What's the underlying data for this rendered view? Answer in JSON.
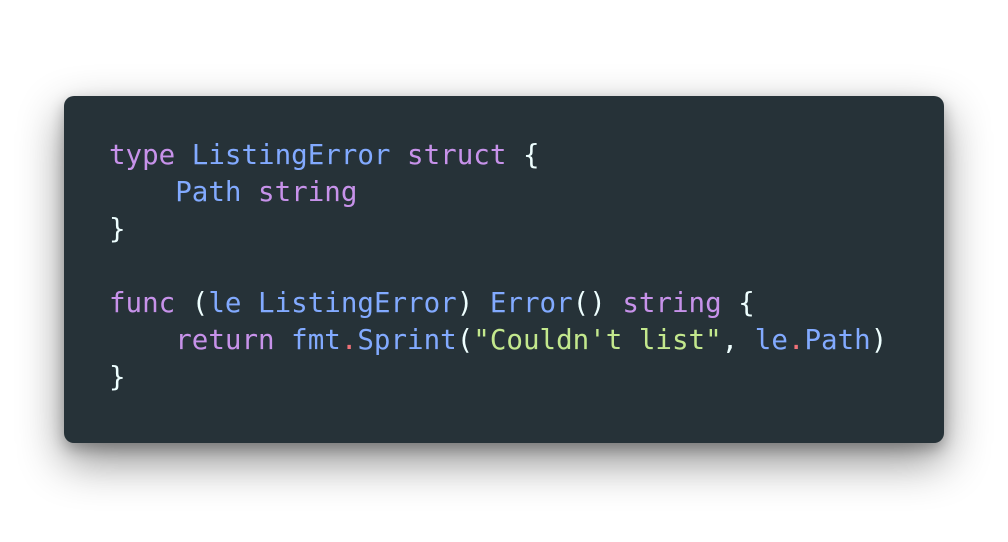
{
  "code": {
    "language": "Go",
    "colors": {
      "background": "#263238",
      "keyword": "#c792ea",
      "type": "#82aaff",
      "function": "#82aaff",
      "identifier": "#eeffff",
      "punctuation": "#eeffff",
      "dot": "#f07178",
      "string": "#c3e88d"
    },
    "lines": [
      [
        {
          "t": "type",
          "c": "kw"
        },
        {
          "t": " ",
          "c": "pn"
        },
        {
          "t": "ListingError",
          "c": "ty"
        },
        {
          "t": " ",
          "c": "pn"
        },
        {
          "t": "struct",
          "c": "kw"
        },
        {
          "t": " {",
          "c": "pn"
        }
      ],
      [
        {
          "t": "    ",
          "c": "pn"
        },
        {
          "t": "Path",
          "c": "ty"
        },
        {
          "t": " ",
          "c": "pn"
        },
        {
          "t": "string",
          "c": "kw"
        }
      ],
      [
        {
          "t": "}",
          "c": "pn"
        }
      ],
      [],
      [
        {
          "t": "func",
          "c": "kw"
        },
        {
          "t": " (",
          "c": "pn"
        },
        {
          "t": "le",
          "c": "ty"
        },
        {
          "t": " ",
          "c": "pn"
        },
        {
          "t": "ListingError",
          "c": "ty"
        },
        {
          "t": ") ",
          "c": "pn"
        },
        {
          "t": "Error",
          "c": "fn"
        },
        {
          "t": "() ",
          "c": "pn"
        },
        {
          "t": "string",
          "c": "kw"
        },
        {
          "t": " {",
          "c": "pn"
        }
      ],
      [
        {
          "t": "    ",
          "c": "pn"
        },
        {
          "t": "return",
          "c": "kw"
        },
        {
          "t": " ",
          "c": "pn"
        },
        {
          "t": "fmt",
          "c": "ty"
        },
        {
          "t": ".",
          "c": "dot"
        },
        {
          "t": "Sprint",
          "c": "fn"
        },
        {
          "t": "(",
          "c": "pn"
        },
        {
          "t": "\"Couldn't list\"",
          "c": "str"
        },
        {
          "t": ", ",
          "c": "pn"
        },
        {
          "t": "le",
          "c": "ty"
        },
        {
          "t": ".",
          "c": "dot"
        },
        {
          "t": "Path",
          "c": "ty"
        },
        {
          "t": ")",
          "c": "pn"
        }
      ],
      [
        {
          "t": "}",
          "c": "pn"
        }
      ]
    ]
  }
}
